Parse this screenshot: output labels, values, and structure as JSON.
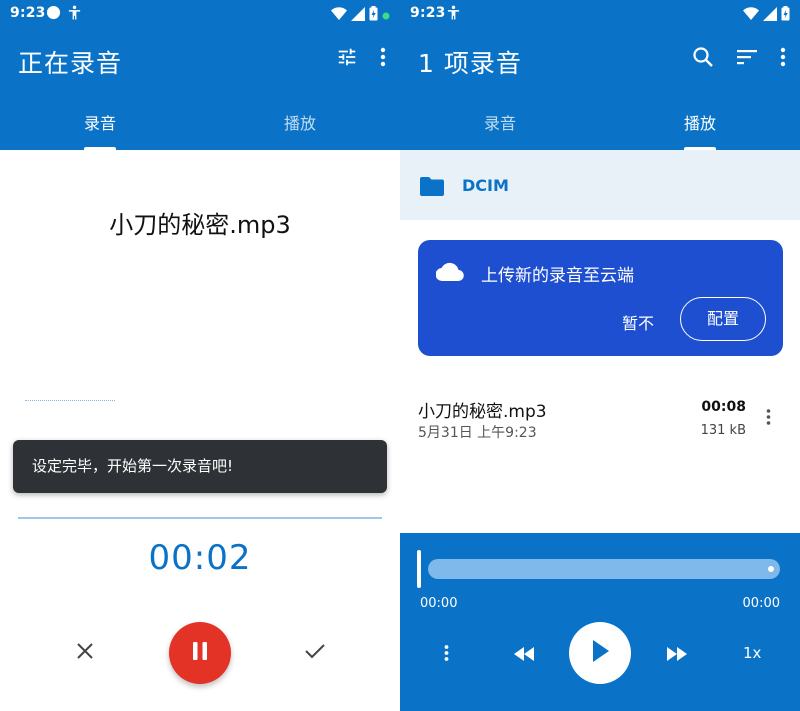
{
  "left": {
    "status": {
      "time": "9:23"
    },
    "title": "正在录音",
    "tabs": [
      {
        "label": "录音",
        "active": true
      },
      {
        "label": "播放",
        "active": false
      }
    ],
    "file_name": "小刀的秘密.mp3",
    "toast": "设定完毕，开始第一次录音吧!",
    "timer": "00:02",
    "controls": {
      "discard_icon": "close-icon",
      "pause_icon": "pause-icon",
      "save_icon": "check-icon"
    }
  },
  "right": {
    "status": {
      "time": "9:23"
    },
    "title": "1 项录音",
    "tabs": [
      {
        "label": "录音",
        "active": false
      },
      {
        "label": "播放",
        "active": true
      }
    ],
    "folder": "DCIM",
    "cloud_card": {
      "message": "上传新的录音至云端",
      "not_now": "暂不",
      "configure": "配置"
    },
    "recording": {
      "name": "小刀的秘密.mp3",
      "date": "5月31日 上午9:23",
      "duration": "00:08",
      "size": "131 kB"
    },
    "player": {
      "elapsed": "00:00",
      "total": "00:00",
      "speed": "1x",
      "progress": 0
    }
  },
  "colors": {
    "primary": "#0a73c7",
    "record_red": "#e33226",
    "card_blue": "#1e4fd0",
    "toast_bg": "#2e3135"
  }
}
